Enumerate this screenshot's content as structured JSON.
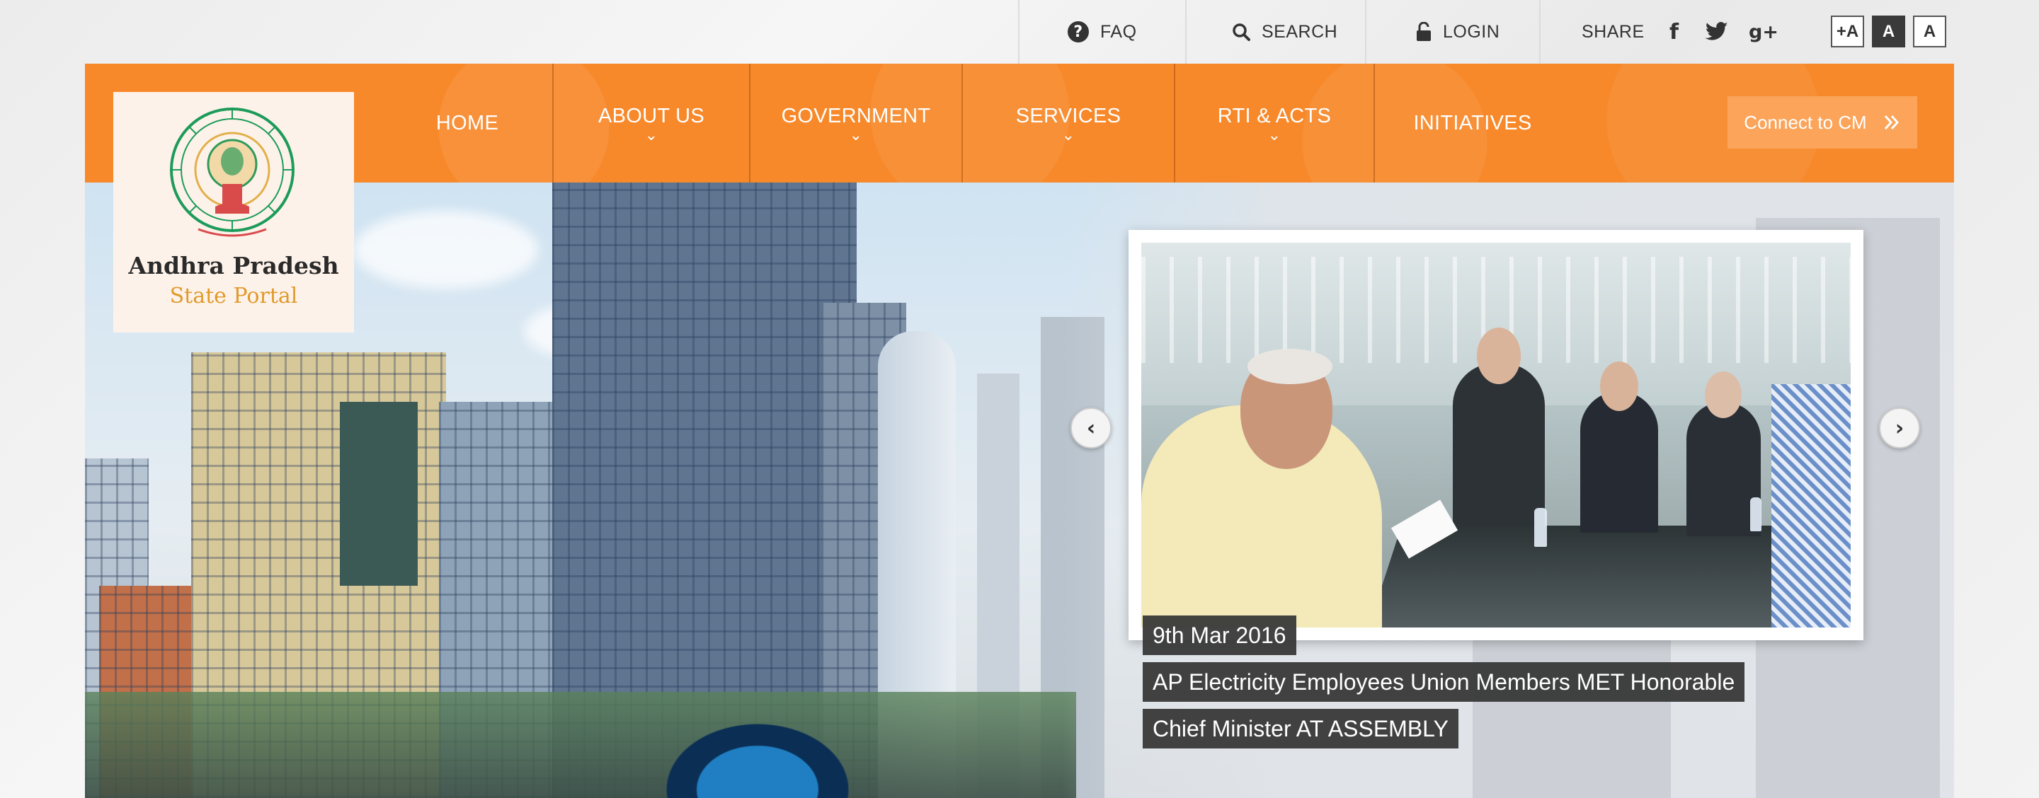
{
  "topbar": {
    "faq_label": "FAQ",
    "search_label": "SEARCH",
    "login_label": "LOGIN",
    "share_label": "SHARE",
    "font_buttons": [
      "+A",
      "A",
      "A"
    ]
  },
  "nav": {
    "items": [
      {
        "label": "HOME",
        "has_dropdown": false
      },
      {
        "label": "ABOUT US",
        "has_dropdown": true
      },
      {
        "label": "GOVERNMENT",
        "has_dropdown": true
      },
      {
        "label": "SERVICES",
        "has_dropdown": true
      },
      {
        "label": "RTI & ACTS",
        "has_dropdown": true
      },
      {
        "label": "INITIATIVES",
        "has_dropdown": false
      }
    ],
    "cta_label": "Connect to CM"
  },
  "logo": {
    "title": "Andhra Pradesh",
    "subtitle": "State Portal"
  },
  "slider": {
    "date": "9th Mar 2016",
    "caption_line1": "AP Electricity Employees Union Members MET Honorable",
    "caption_line2": "Chief Minister AT ASSEMBLY"
  },
  "colors": {
    "brand_orange": "#f7892b",
    "cta_orange": "#fba45a",
    "caption_bg": "#333333",
    "logo_gold": "#e09a2a"
  },
  "icons": {
    "faq": "question-circle-icon",
    "search": "search-icon",
    "login": "unlock-icon",
    "facebook": "facebook-icon",
    "twitter": "twitter-icon",
    "googleplus": "google-plus-icon",
    "dropdown": "chevron-down-icon",
    "cta": "double-chevron-right-icon",
    "prev": "chevron-left-icon",
    "next": "chevron-right-icon"
  }
}
